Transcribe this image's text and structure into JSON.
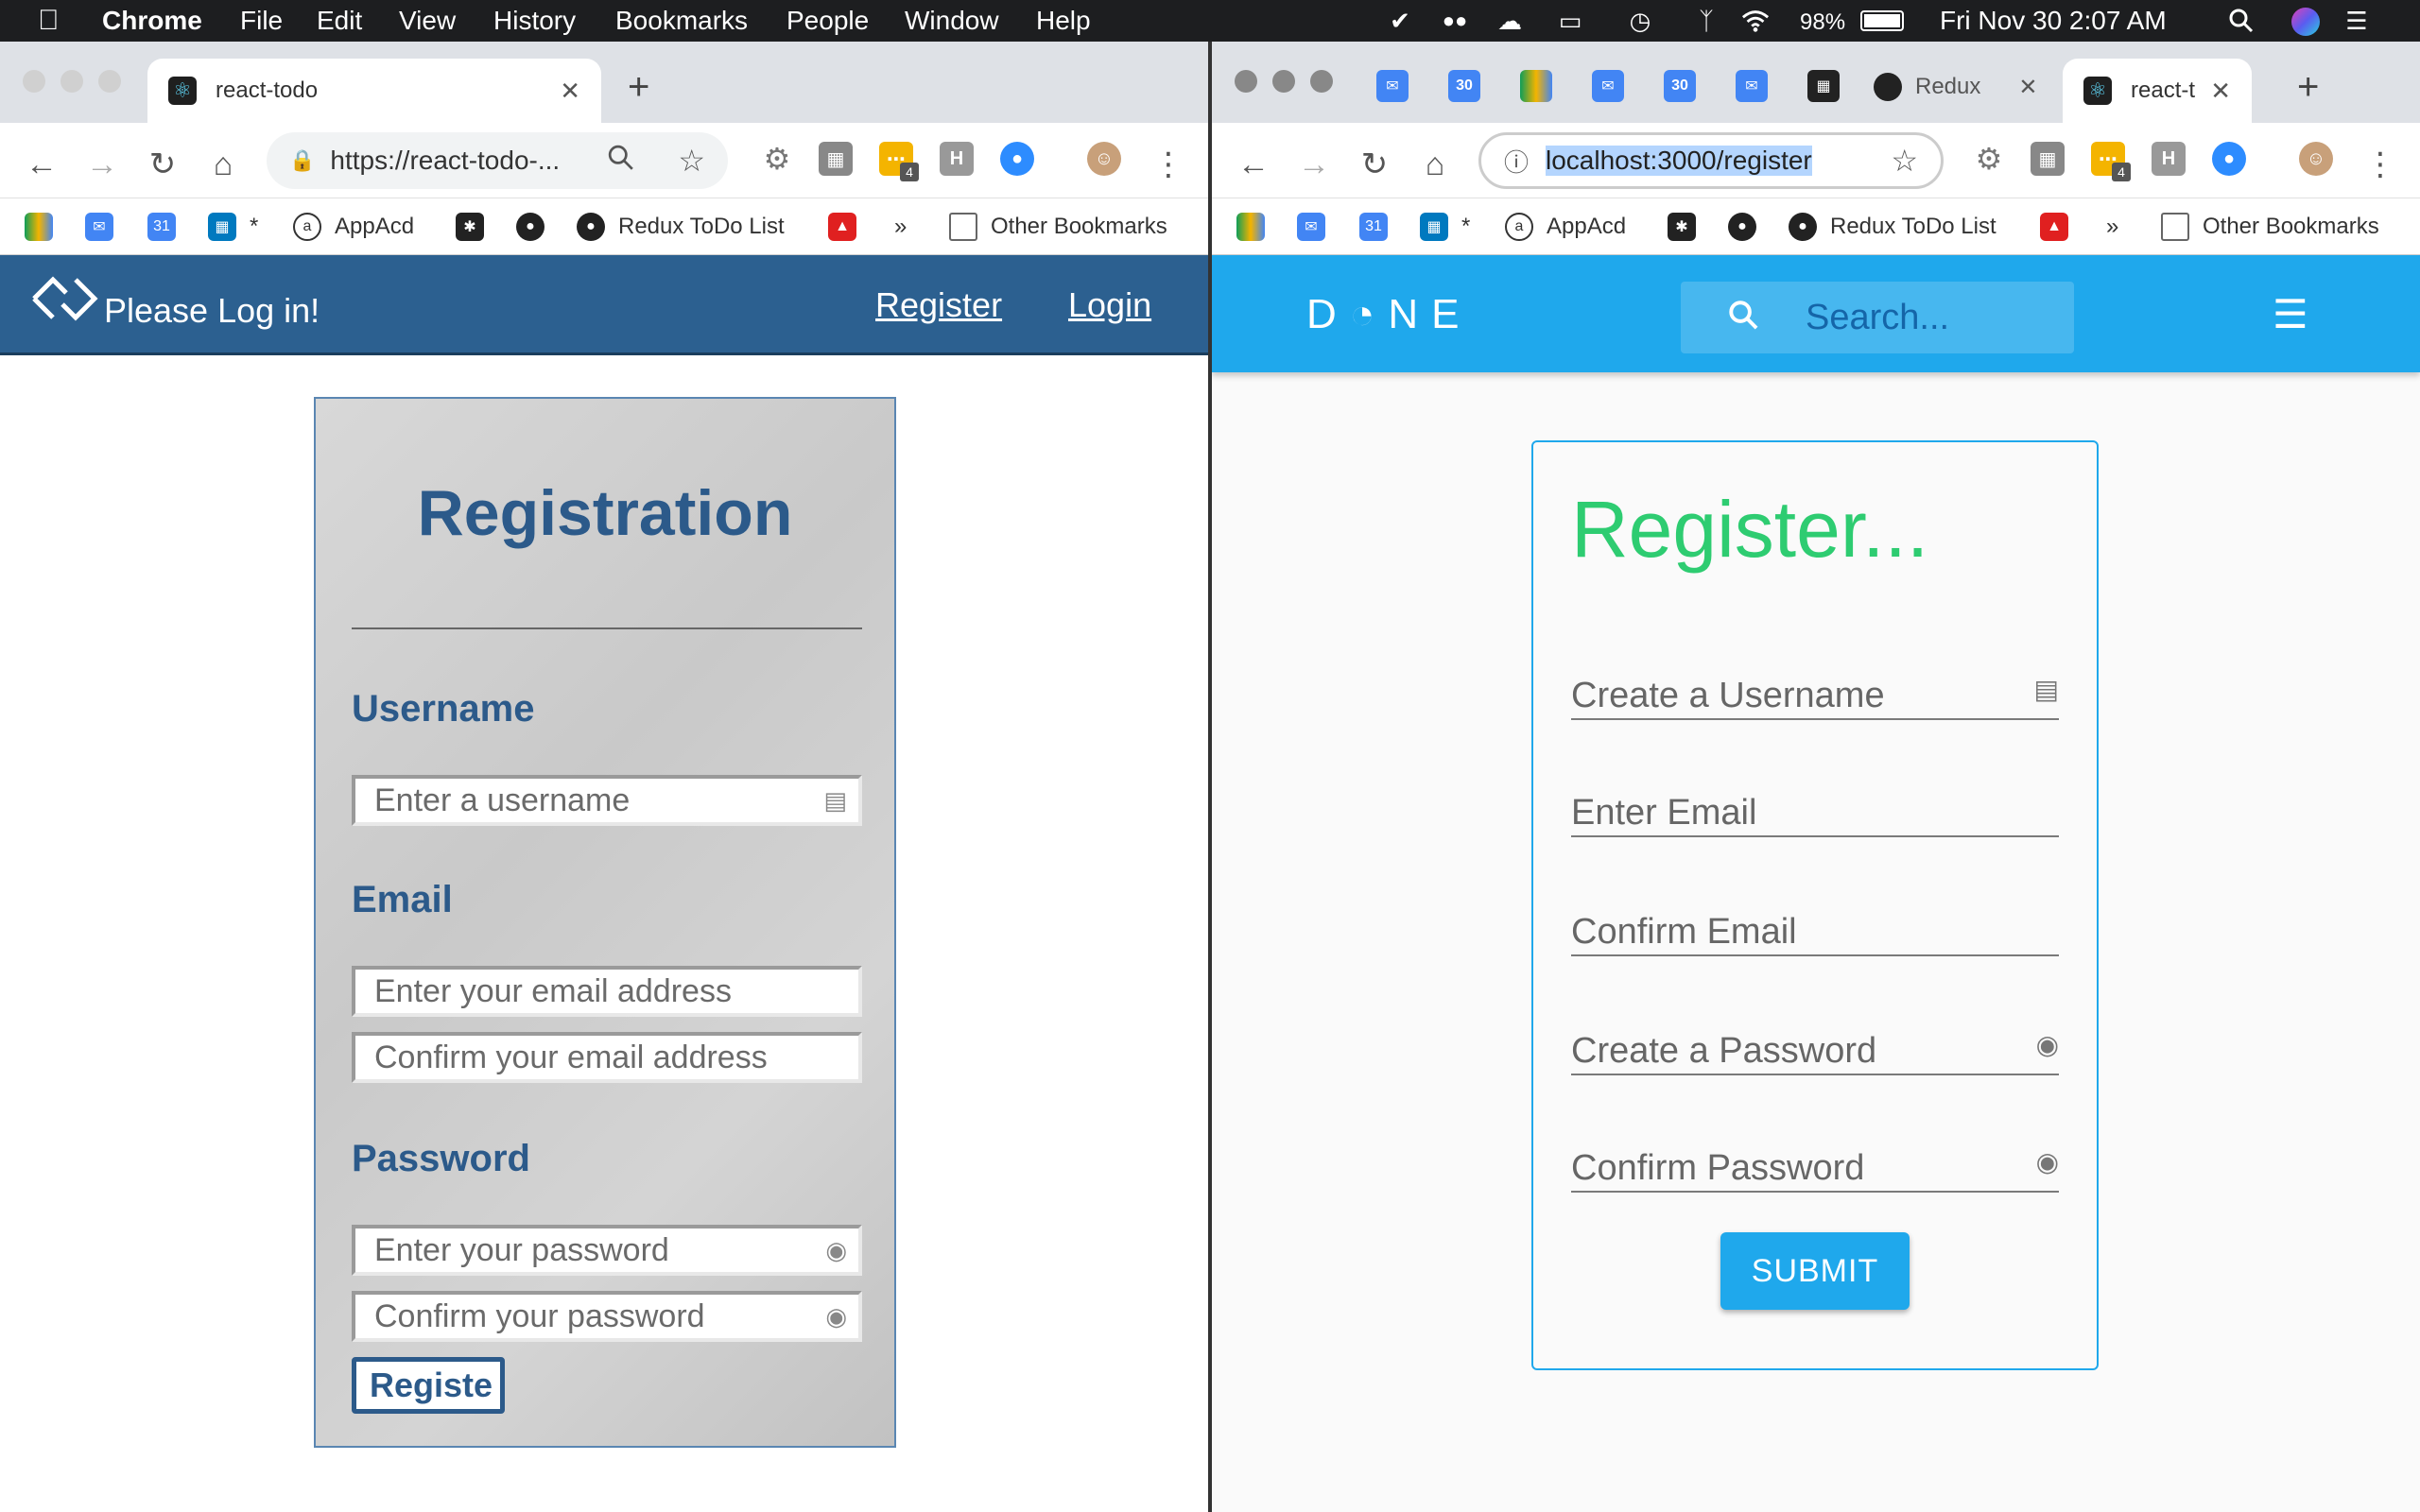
{
  "menubar": {
    "apple": "",
    "app": "Chrome",
    "menus": [
      "File",
      "Edit",
      "View",
      "History",
      "Bookmarks",
      "People",
      "Window",
      "Help"
    ],
    "battery": "98%",
    "clock": "Fri Nov 30  2:07 AM"
  },
  "left_window": {
    "tab_title": "react-todo",
    "url": "https://react-todo-...",
    "bookmarks": {
      "appacd": "AppAcd",
      "redux": "Redux ToDo List",
      "more": "»",
      "other": "Other Bookmarks",
      "star": "*"
    },
    "site": {
      "nav_title": "Please Log in!",
      "nav_register": "Register",
      "nav_login": "Login",
      "form_title": "Registration",
      "username_heading": "Username",
      "username_placeholder": "Enter a username",
      "email_heading": "Email",
      "email_placeholder": "Enter your email address",
      "email_confirm_placeholder": "Confirm your email address",
      "password_heading": "Password",
      "password_placeholder": "Enter your password",
      "password_confirm_placeholder": "Confirm your password",
      "submit": "Registe"
    }
  },
  "right_window": {
    "tab_redux": "Redux",
    "tab_title": "react-t",
    "url": "localhost:3000/register",
    "pinned_calendar_day": "30",
    "ext_badge": "4",
    "bookmarks": {
      "appacd": "AppAcd",
      "redux": "Redux ToDo List",
      "more": "»",
      "other": "Other Bookmarks",
      "star": "*"
    },
    "site": {
      "logo": "D◔NE",
      "search_placeholder": "Search...",
      "form_title": "Register...",
      "fields": [
        "Create a Username",
        "Enter Email",
        "Confirm Email",
        "Create a Password",
        "Confirm Password"
      ],
      "submit": "SUBMIT"
    }
  },
  "colors": {
    "left_nav": "#2c6090",
    "left_heading": "#2c5a8a",
    "right_nav": "#1fa8ec",
    "right_title": "#2ecc71",
    "submit": "#1fa8ec"
  },
  "icons": [
    "apple-icon",
    "wifi-icon",
    "battery-icon",
    "bluetooth-icon",
    "search-icon",
    "id-card-icon",
    "lock-icon",
    "hamburger-menu-icon",
    "github-icon",
    "google-drive-icon"
  ]
}
